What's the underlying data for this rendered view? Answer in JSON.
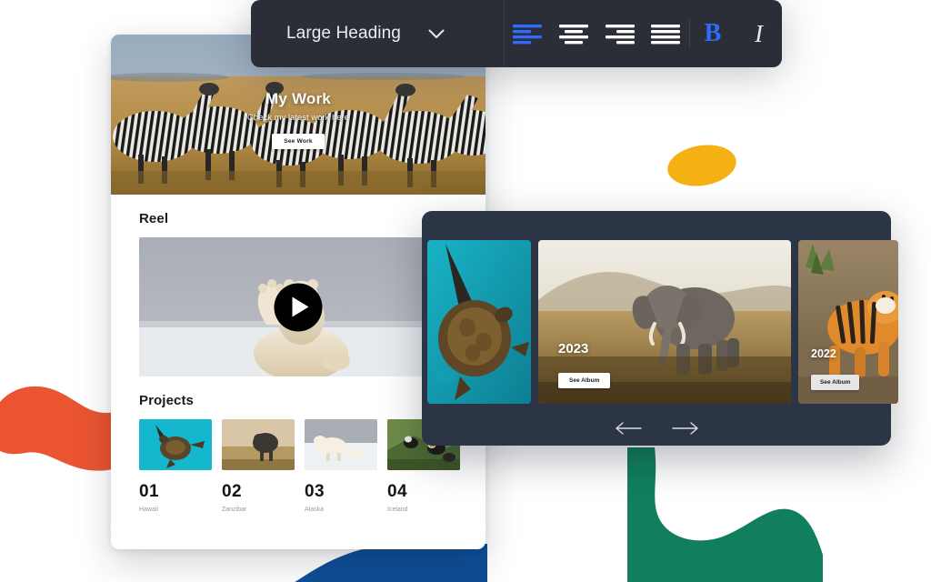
{
  "toolbar": {
    "dropdown": {
      "label": "Large Heading",
      "icon": "chevron-down-icon"
    },
    "align_buttons": [
      {
        "name": "align-left",
        "icon": "align-left-icon",
        "active": true,
        "color": "#2F6BFF"
      },
      {
        "name": "align-center",
        "icon": "align-center-icon",
        "active": false,
        "color": "#FFFFFF"
      },
      {
        "name": "align-right",
        "icon": "align-right-icon",
        "active": false,
        "color": "#FFFFFF"
      },
      {
        "name": "align-justify",
        "icon": "align-justify-icon",
        "active": false,
        "color": "#FFFFFF"
      }
    ],
    "format_buttons": [
      {
        "name": "bold",
        "label": "B",
        "active": true,
        "color": "#2F6BFF"
      },
      {
        "name": "italic",
        "label": "I",
        "active": false,
        "color": "#E9E9EC"
      }
    ],
    "background": "#2B2E37"
  },
  "site_card": {
    "hero": {
      "title": "My Work",
      "subtitle": "Check my latest work here",
      "button_label": "See Work",
      "image_alt": "zebras-in-savanna"
    },
    "reel": {
      "heading": "Reel",
      "play_icon": "play-icon",
      "image_alt": "polar-bear-waving"
    },
    "projects": {
      "heading": "Projects",
      "items": [
        {
          "number": "01",
          "location": "Hawaii",
          "image_alt": "sea-turtle"
        },
        {
          "number": "02",
          "location": "Zanzibar",
          "image_alt": "elephant"
        },
        {
          "number": "03",
          "location": "Alaska",
          "image_alt": "polar-bears"
        },
        {
          "number": "04",
          "location": "Iceland",
          "image_alt": "puffins"
        }
      ]
    }
  },
  "gallery_panel": {
    "background": "#2C3545",
    "cards": [
      {
        "year": "",
        "button_label": "",
        "image_alt": "sea-turtle-underwater"
      },
      {
        "year": "2023",
        "button_label": "See Album",
        "image_alt": "elephant-savanna"
      },
      {
        "year": "2022",
        "button_label": "See Album",
        "image_alt": "tiger"
      }
    ],
    "nav": {
      "prev_icon": "arrow-left-icon",
      "next_icon": "arrow-right-icon"
    }
  },
  "decor": {
    "blob_orange": "#EA5430",
    "blob_green": "#117F5E",
    "blob_blue": "#0E4E96",
    "blob_yellow": "#F5B014"
  }
}
